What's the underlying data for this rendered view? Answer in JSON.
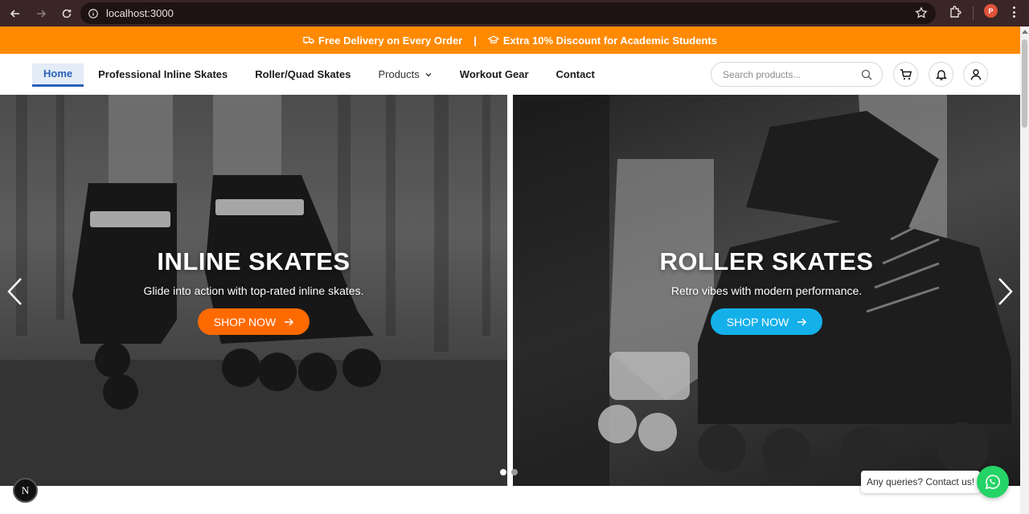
{
  "browser": {
    "url": "localhost:3000",
    "profile_initial": "P"
  },
  "announcement": {
    "delivery": "Free Delivery on Every Order",
    "separator": "|",
    "discount": "Extra 10% Discount for Academic Students"
  },
  "nav": {
    "items": [
      {
        "label": "Home",
        "active": true
      },
      {
        "label": "Professional Inline Skates"
      },
      {
        "label": "Roller/Quad Skates"
      },
      {
        "label": "Products",
        "dropdown": true
      },
      {
        "label": "Workout Gear"
      },
      {
        "label": "Contact"
      }
    ]
  },
  "search": {
    "placeholder": "Search products..."
  },
  "hero": {
    "slides": [
      {
        "title": "INLINE SKATES",
        "subtitle": "Glide into action with top-rated inline skates.",
        "cta": "SHOP NOW",
        "cta_color": "#ff6a00"
      },
      {
        "title": "ROLLER SKATES",
        "subtitle": "Retro vibes with modern performance.",
        "cta": "SHOP NOW",
        "cta_color": "#14b0ea"
      }
    ],
    "dots": 2,
    "active_dot": 0
  },
  "floating": {
    "next_badge": "N",
    "contact_text": "Any queries? Contact us!"
  },
  "colors": {
    "announcement_bg": "#ff8a00",
    "active_nav": "#2a5fb8",
    "whatsapp": "#25d366"
  },
  "icons": [
    "back-icon",
    "forward-icon",
    "reload-icon",
    "info-icon",
    "star-icon",
    "extensions-icon",
    "menu-icon",
    "truck-icon",
    "graduation-cap-icon",
    "chevron-down-icon",
    "search-icon",
    "cart-icon",
    "bell-icon",
    "user-icon",
    "chevron-left-icon",
    "chevron-right-icon",
    "arrow-right-icon",
    "whatsapp-icon"
  ]
}
